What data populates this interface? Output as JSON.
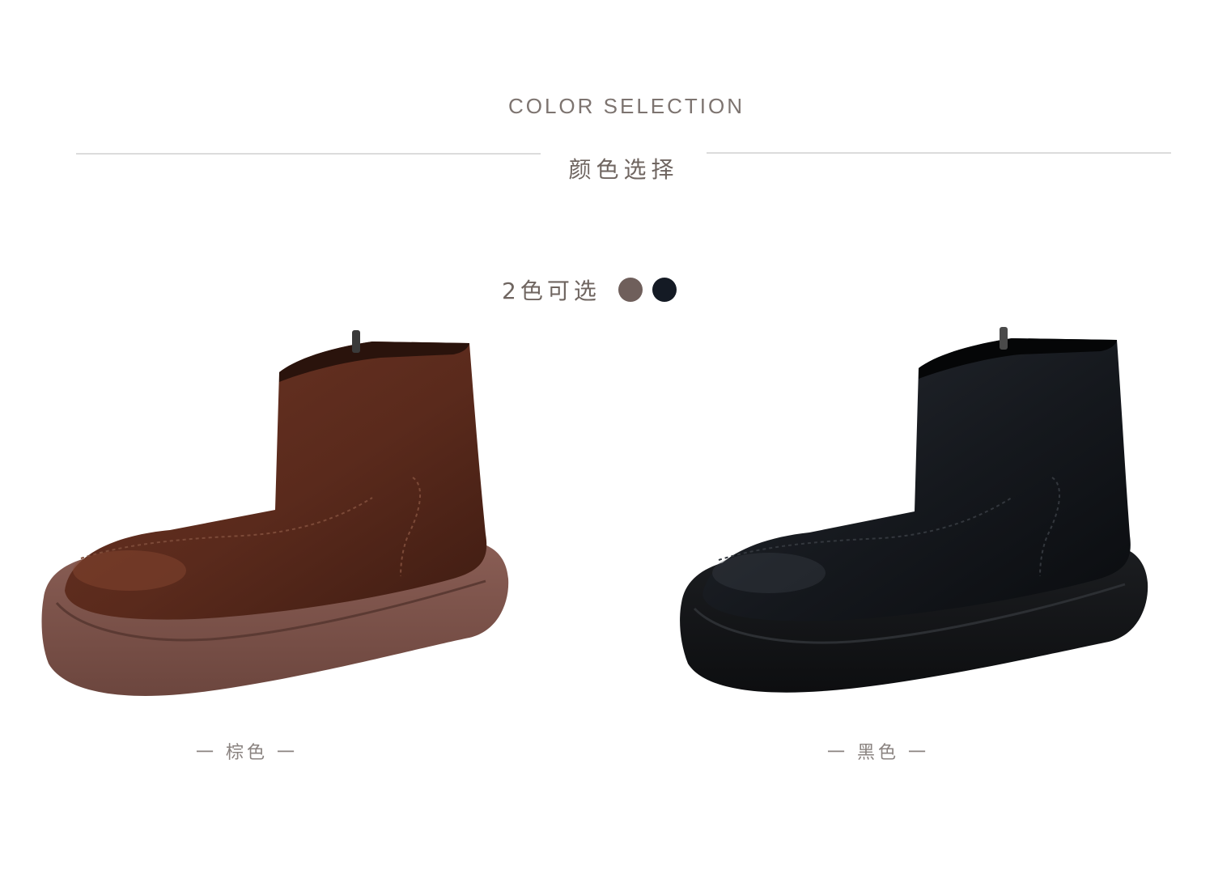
{
  "header": {
    "title_en": "COLOR SELECTION",
    "title_cn": "颜色选择"
  },
  "options": {
    "label": "2色可选",
    "swatches": [
      {
        "name": "brown-swatch",
        "color": "#6f5f5b"
      },
      {
        "name": "black-swatch",
        "color": "#141a24"
      }
    ]
  },
  "products": [
    {
      "caption": "一 棕色 一",
      "upper_color": "#5a2a1c",
      "sole_color": "#7a5048"
    },
    {
      "caption": "一 黑色 一",
      "upper_color": "#15181d",
      "sole_color": "#101214"
    }
  ]
}
